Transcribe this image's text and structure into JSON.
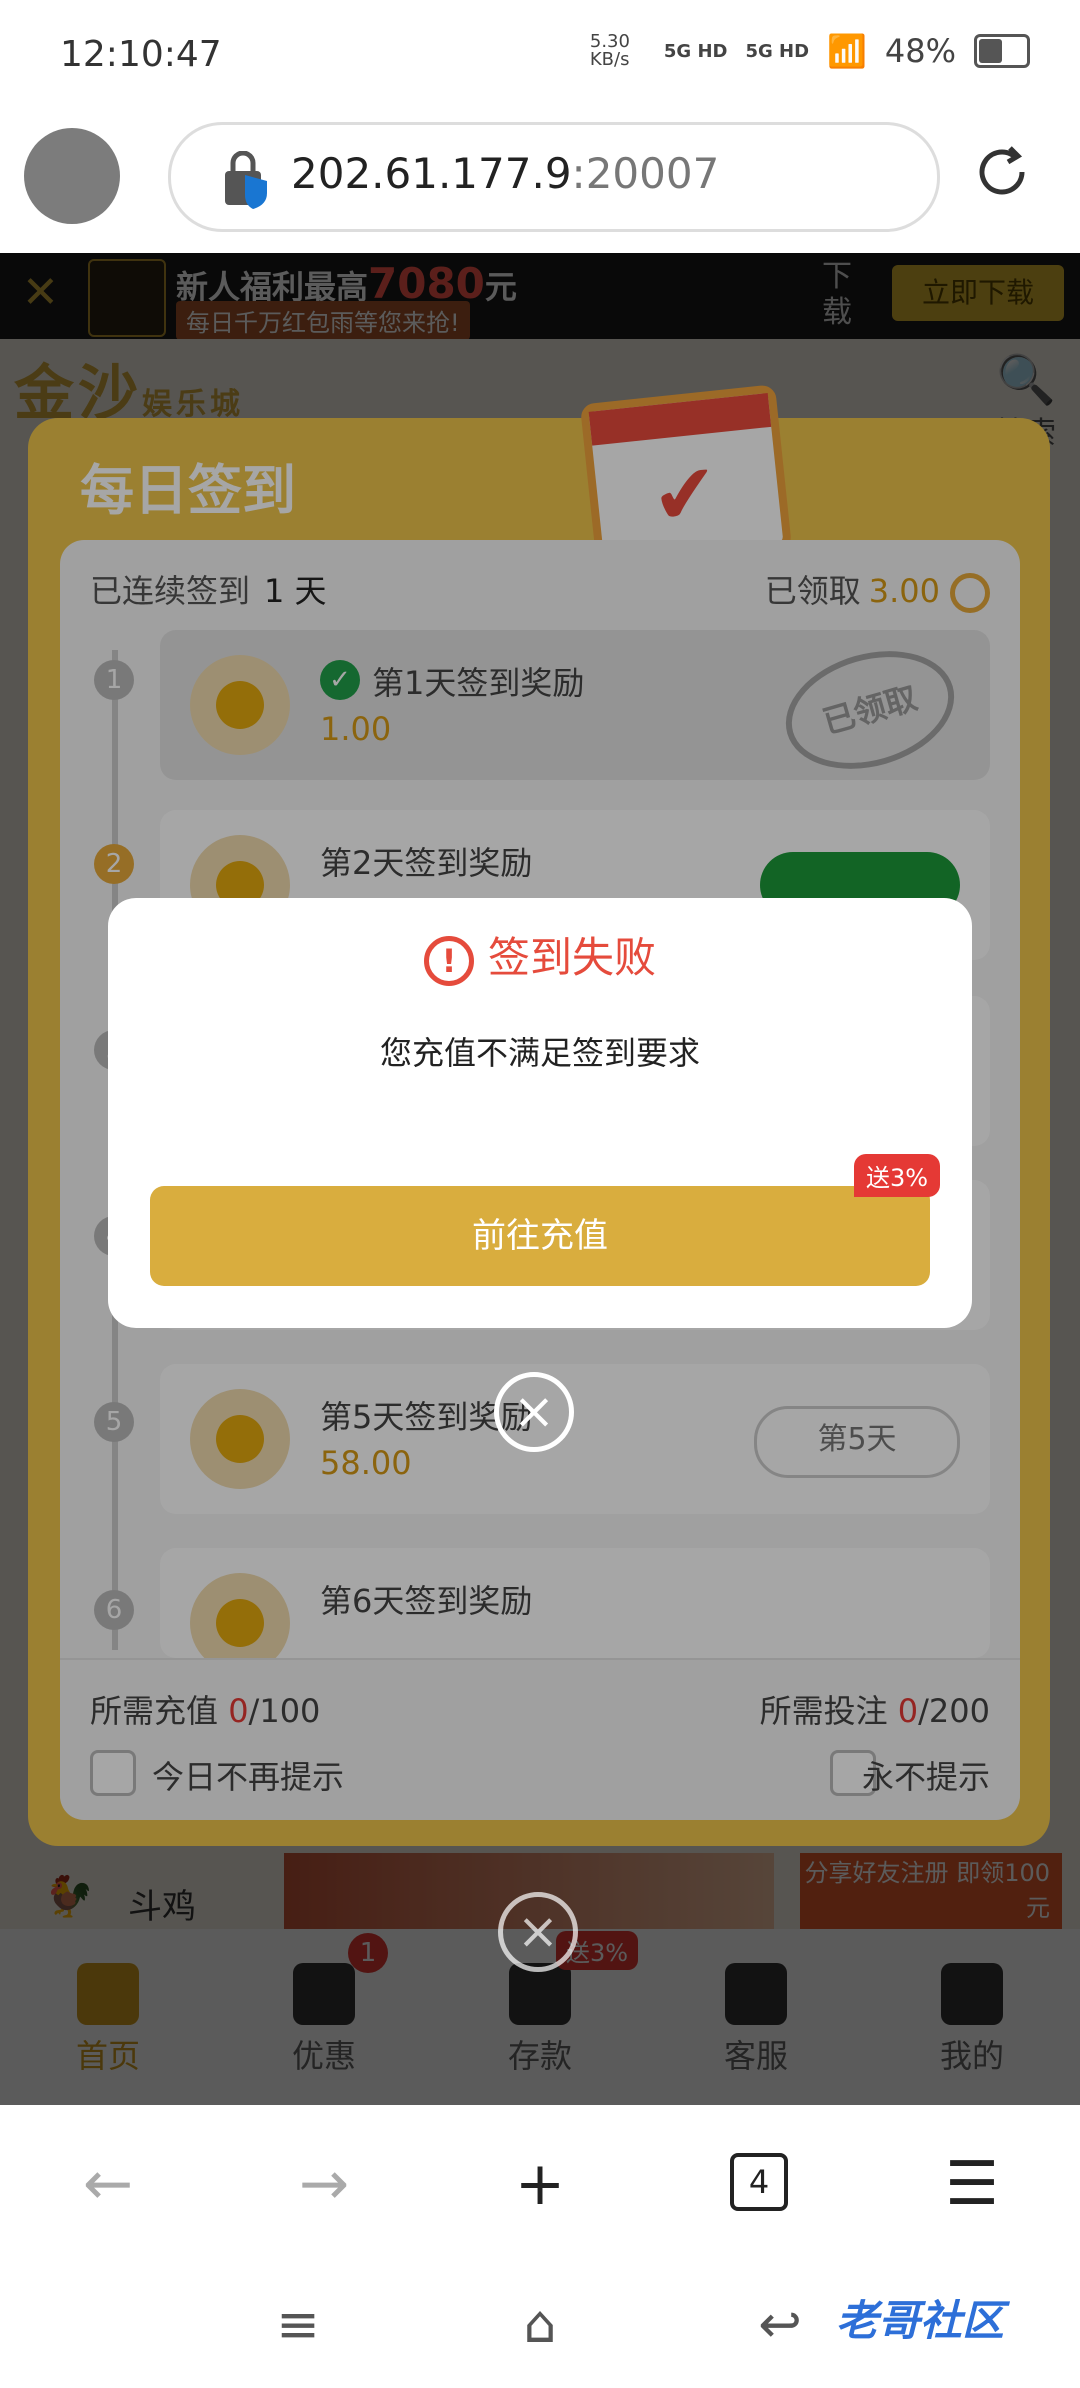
{
  "status": {
    "time": "12:10:47",
    "net_speed": "5.30 KB/s",
    "sig1": "5G HD",
    "sig2": "5G HD",
    "battery": "48%"
  },
  "browser": {
    "url_host": "202.61.177.9",
    "url_port": ":20007",
    "tabs_count": "4"
  },
  "banner": {
    "headline": "新人福利最高",
    "amount": "7080",
    "unit": "元",
    "sub": "每日千万红包雨等您来抢!",
    "download": "下载",
    "cta": "立即下载"
  },
  "site": {
    "brand": "金沙",
    "brand_sub": "娱乐城",
    "search": "搜索"
  },
  "checkin": {
    "title": "每日签到",
    "streak_label": "已连续签到",
    "streak_value": "1 天",
    "claimed_label": "已领取",
    "claimed_value": "3.00",
    "days": [
      {
        "num": "1",
        "label": "第1天签到奖励",
        "amount": "1.00",
        "stamp": "已领取"
      },
      {
        "num": "2",
        "label": "第2天签到奖励"
      },
      {
        "num": "3"
      },
      {
        "num": "4"
      },
      {
        "num": "5",
        "label": "第5天签到奖励",
        "amount": "58.00",
        "btn": "第5天"
      },
      {
        "num": "6",
        "label": "第6天签到奖励"
      }
    ],
    "recharge_label": "所需充值",
    "recharge_cur": "0",
    "recharge_total": "/100",
    "bet_label": "所需投注",
    "bet_cur": "0",
    "bet_total": "/200",
    "opt_today": "今日不再提示",
    "opt_never": "永不提示"
  },
  "modal": {
    "title": "签到失败",
    "message": "您充值不满足签到要求",
    "button": "前往充值",
    "bonus_tag": "送3%"
  },
  "tabbar": {
    "items": [
      "首页",
      "优惠",
      "存款",
      "客服",
      "我的"
    ],
    "badge": "1",
    "promo_tag": "送3%",
    "douji": "斗鸡",
    "promo2": "分享好友注册 即领100元"
  },
  "watermark": "老哥社区",
  "colors": {
    "accent": "#d49f1f",
    "error": "#e54b3c",
    "success": "#1c9a3a"
  }
}
